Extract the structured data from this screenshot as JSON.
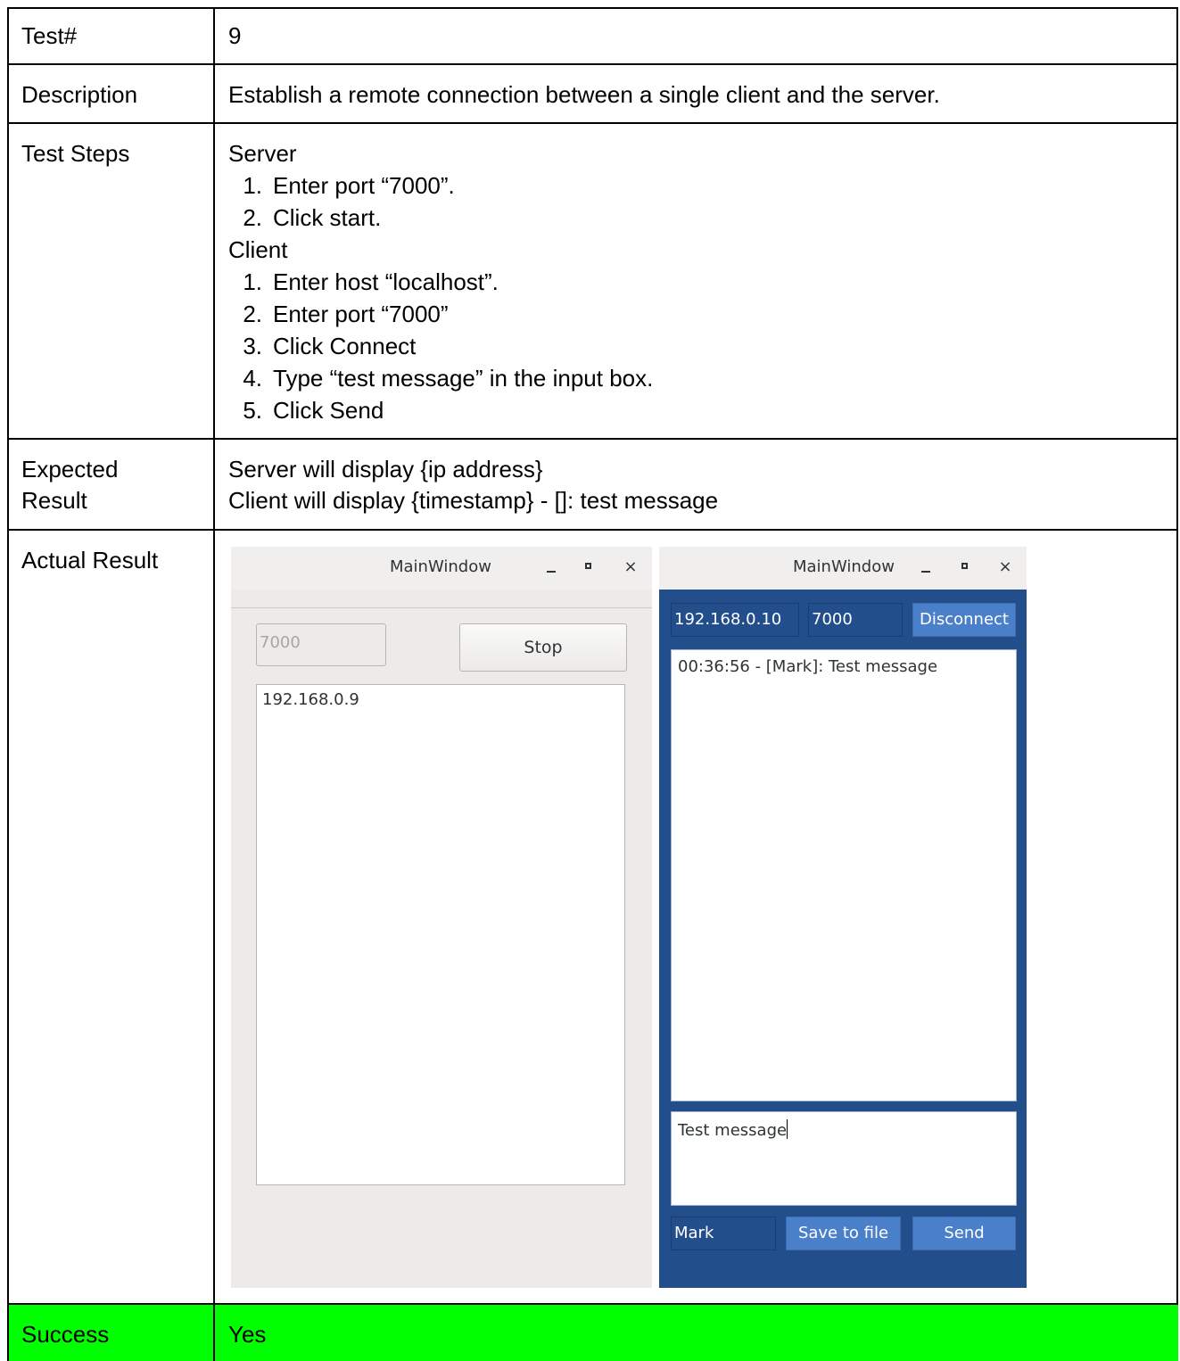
{
  "table": {
    "test_label": "Test#",
    "test_value": "9",
    "description_label": "Description",
    "description_value": "Establish a remote connection between a single client and the server.",
    "steps_label": "Test Steps",
    "server_heading": "Server",
    "server_steps": [
      "Enter port “7000”.",
      "Click start."
    ],
    "client_heading": "Client",
    "client_steps": [
      "Enter host “localhost”.",
      "Enter port “7000”",
      "Click Connect",
      "Type “test message” in the input box.",
      "Click Send"
    ],
    "expected_label_line1": "Expected",
    "expected_label_line2": "Result",
    "expected_line1": "Server will display {ip address}",
    "expected_line2": "Client will display {timestamp} - []: test message",
    "actual_label": "Actual Result",
    "success_label": "Success",
    "success_value": "Yes",
    "success_color": "#00ff00"
  },
  "server_window": {
    "title": "MainWindow",
    "port_value": "7000",
    "stop_label": "Stop",
    "clients": [
      "192.168.0.9"
    ]
  },
  "client_window": {
    "title": "MainWindow",
    "host_value": "192.168.0.10",
    "port_value": "7000",
    "disconnect_label": "Disconnect",
    "messages": [
      "00:36:56 - [Mark]: Test message"
    ],
    "input_value": "Test message",
    "name_value": "Mark",
    "save_label": "Save to file",
    "send_label": "Send",
    "body_color": "#234e8c"
  },
  "icons": {
    "close": "×"
  }
}
